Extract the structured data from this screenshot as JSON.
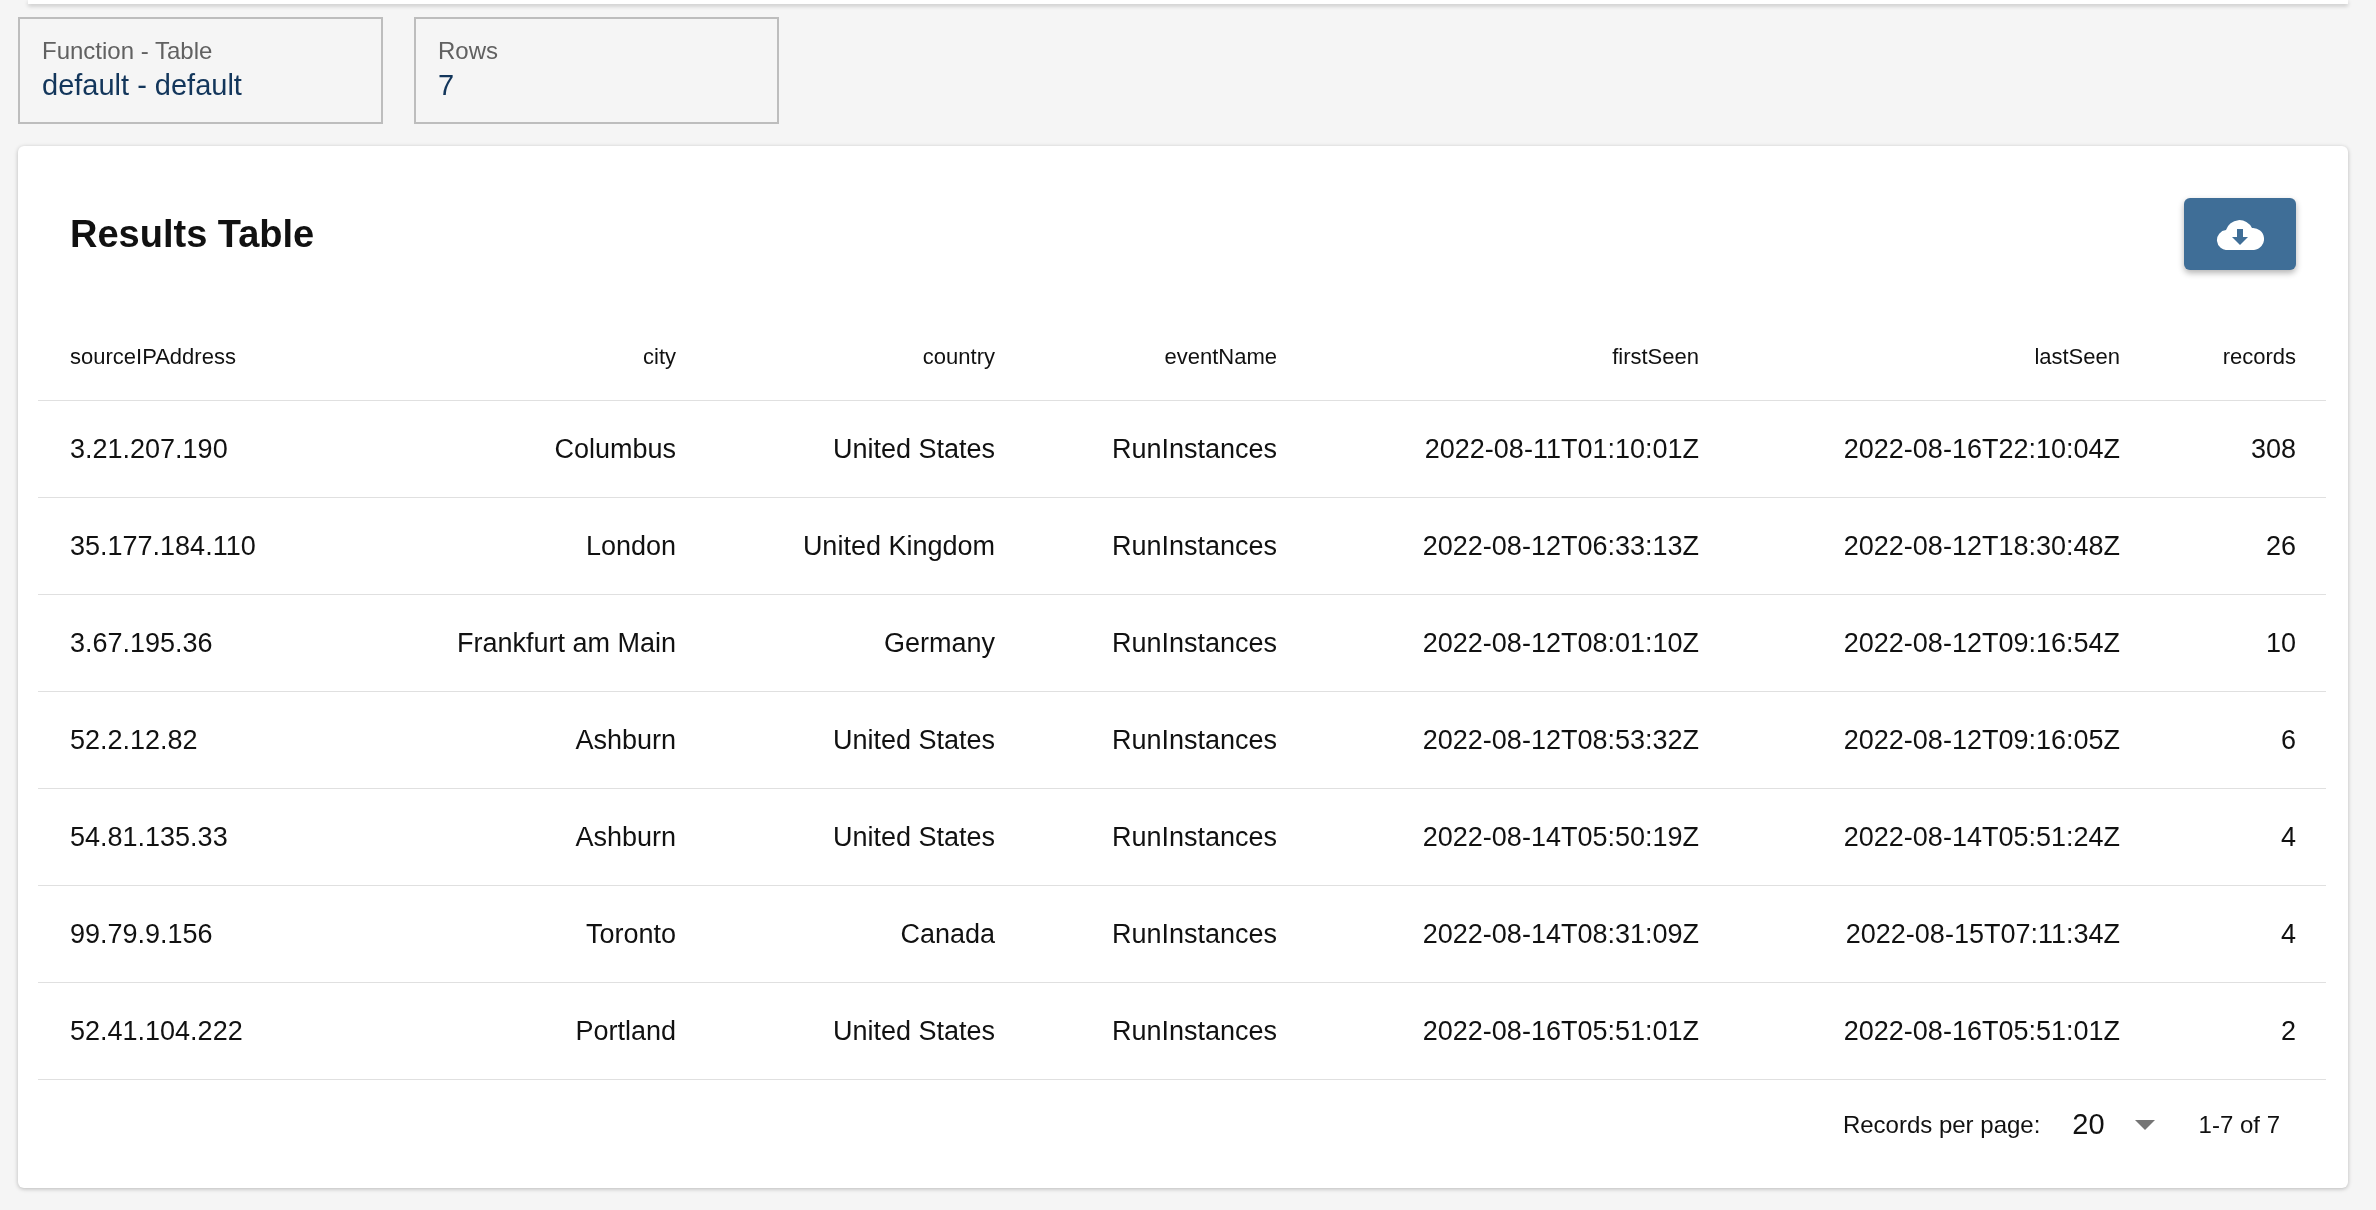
{
  "summary_cards": [
    {
      "label": "Function - Table",
      "value": "default - default"
    },
    {
      "label": "Rows",
      "value": "7"
    }
  ],
  "results": {
    "title": "Results Table",
    "columns": [
      "sourceIPAddress",
      "city",
      "country",
      "eventName",
      "firstSeen",
      "lastSeen",
      "records"
    ],
    "rows": [
      [
        "3.21.207.190",
        "Columbus",
        "United States",
        "RunInstances",
        "2022-08-11T01:10:01Z",
        "2022-08-16T22:10:04Z",
        "308"
      ],
      [
        "35.177.184.110",
        "London",
        "United Kingdom",
        "RunInstances",
        "2022-08-12T06:33:13Z",
        "2022-08-12T18:30:48Z",
        "26"
      ],
      [
        "3.67.195.36",
        "Frankfurt am Main",
        "Germany",
        "RunInstances",
        "2022-08-12T08:01:10Z",
        "2022-08-12T09:16:54Z",
        "10"
      ],
      [
        "52.2.12.82",
        "Ashburn",
        "United States",
        "RunInstances",
        "2022-08-12T08:53:32Z",
        "2022-08-12T09:16:05Z",
        "6"
      ],
      [
        "54.81.135.33",
        "Ashburn",
        "United States",
        "RunInstances",
        "2022-08-14T05:50:19Z",
        "2022-08-14T05:51:24Z",
        "4"
      ],
      [
        "99.79.9.156",
        "Toronto",
        "Canada",
        "RunInstances",
        "2022-08-14T08:31:09Z",
        "2022-08-15T07:11:34Z",
        "4"
      ],
      [
        "52.41.104.222",
        "Portland",
        "United States",
        "RunInstances",
        "2022-08-16T05:51:01Z",
        "2022-08-16T05:51:01Z",
        "2"
      ]
    ],
    "pagination": {
      "per_page_label": "Records per page:",
      "per_page": "20",
      "range": "1-7 of 7"
    }
  }
}
